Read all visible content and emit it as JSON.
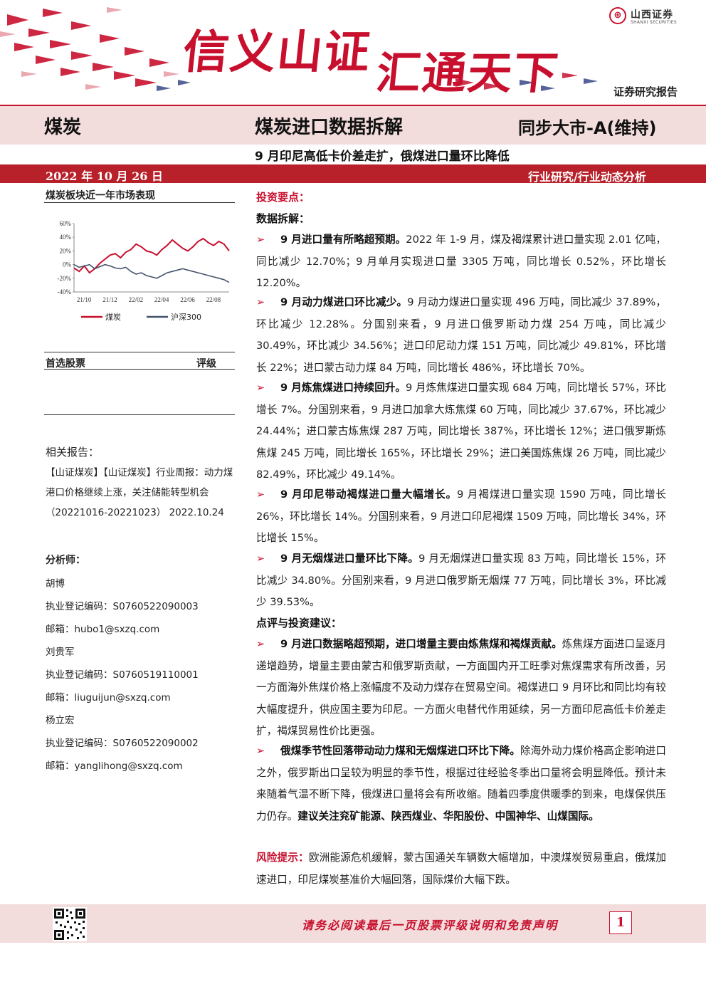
{
  "header": {
    "slogan_part1": "信义山证",
    "slogan_part2": "汇通天下",
    "logo_cn": "山西证券",
    "logo_en": "SHANXI SECURITIES",
    "report_type": "证券研究报告"
  },
  "title_band": {
    "industry": "煤炭",
    "title": "煤炭进口数据拆解",
    "rating": "同步大市-A(维持)",
    "subtitle": "9 月印尼高低卡价差走扩，俄煤进口量环比降低",
    "date": "2022 年 10 月 26 日",
    "research_type": "行业研究/行业动态分析"
  },
  "left": {
    "chart_title": "煤炭板块近一年市场表现",
    "stock_header_left": "首选股票",
    "stock_header_right": "评级",
    "related_title": "相关报告：",
    "related_text": "【山证煤炭】【山证煤炭】行业周报：动力煤港口价格继续上涨，关注储能转型机会（20221016-20221023） 2022.10.24",
    "analyst_title": "分析师：",
    "analysts": [
      "胡博",
      "执业登记编码：S0760522090003",
      "邮箱：hubo1@sxzq.com",
      "刘贵军",
      "执业登记编码：S0760519110001",
      "邮箱：liuguijun@sxzq.com",
      "杨立宏",
      "执业登记编码：S0760522090002",
      "邮箱：yanglihong@sxzq.com"
    ]
  },
  "chart_data": {
    "type": "line",
    "title": "煤炭板块近一年市场表现",
    "x_ticks": [
      "21/10",
      "21/12",
      "22/02",
      "22/04",
      "22/06",
      "22/08"
    ],
    "y_ticks": [
      "60%",
      "40%",
      "20%",
      "0%",
      "-20%",
      "-40%"
    ],
    "ylim": [
      -40,
      60
    ],
    "legend_placement": "bottom",
    "series": [
      {
        "name": "煤炭",
        "color": "#c8102e",
        "values": [
          -5,
          -10,
          -2,
          -12,
          -6,
          2,
          8,
          14,
          16,
          10,
          18,
          22,
          30,
          26,
          20,
          18,
          14,
          22,
          28,
          36,
          30,
          24,
          20,
          26,
          34,
          38,
          32,
          28,
          34,
          30,
          20
        ]
      },
      {
        "name": "沪深300",
        "color": "#44546a",
        "values": [
          0,
          -4,
          -2,
          0,
          -6,
          -3,
          0,
          -2,
          -5,
          -6,
          -4,
          -10,
          -14,
          -12,
          -16,
          -18,
          -20,
          -16,
          -12,
          -10,
          -8,
          -6,
          -8,
          -10,
          -12,
          -14,
          -16,
          -18,
          -20,
          -22,
          -26
        ]
      }
    ]
  },
  "right": {
    "invest_title": "投资要点：",
    "data_title": "数据拆解：",
    "bullets": [
      {
        "lead": "9 月进口量有所略超预期。",
        "text": "2022 年 1-9 月，煤及褐煤累计进口量实现 2.01 亿吨，同比减少 12.70%；9 月单月实现进口量 3305 万吨，同比增长 0.52%，环比增长 12.20%。"
      },
      {
        "lead": "9 月动力煤进口环比减少。",
        "text": "9 月动力煤进口量实现 496 万吨，同比减少 37.89%，环比减少 12.28%。分国别来看，9 月进口俄罗斯动力煤 254 万吨，同比减少 30.49%，环比减少 34.56%；进口印尼动力煤 151 万吨，同比减少 49.81%，环比增长 22%；进口蒙古动力煤 84 万吨，同比增长 486%，环比增长 70%。"
      },
      {
        "lead": "9 月炼焦煤进口持续回升。",
        "text": "9 月炼焦煤进口量实现 684 万吨，同比增长 57%，环比增长 7%。分国别来看，9 月进口加拿大炼焦煤 60 万吨，同比减少 37.67%，环比减少 24.44%；进口蒙古炼焦煤 287 万吨，同比增长 387%，环比增长 12%；进口俄罗斯炼焦煤 245 万吨，同比增长 165%，环比增长 29%；进口美国炼焦煤 26 万吨，同比减少 82.49%，环比减少 49.14%。"
      },
      {
        "lead": "9 月印尼带动褐煤进口量大幅增长。",
        "text": "9 月褐煤进口量实现 1590 万吨，同比增长 26%，环比增长 14%。分国别来看，9 月进口印尼褐煤 1509 万吨，同比增长 34%，环比增长 15%。"
      },
      {
        "lead": "9 月无烟煤进口量环比下降。",
        "text": "9 月无烟煤进口量实现 83 万吨，同比增长 15%，环比减少 34.80%。分国别来看，9 月进口俄罗斯无烟煤 77 万吨，同比增长 3%，环比减少 39.53%。"
      }
    ],
    "comment_title": "点评与投资建议：",
    "advice": [
      {
        "lead": "9 月进口数据略超预期，进口增量主要由炼焦煤和褐煤贡献。",
        "text": "炼焦煤方面进口呈逐月递增趋势，增量主要由蒙古和俄罗斯贡献，一方面国内开工旺季对焦煤需求有所改善，另一方面海外焦煤价格上涨幅度不及动力煤存在贸易空间。褐煤进口 9 月环比和同比均有较大幅度提升，供应国主要为印尼。一方面火电替代作用延续，另一方面印尼高低卡价差走扩，褐煤贸易性价比更强。"
      },
      {
        "lead": "俄煤季节性回落带动动力煤和无烟煤进口环比下降。",
        "text": "除海外动力煤价格高企影响进口之外，俄罗斯出口呈较为明显的季节性，根据过往经验冬季出口量将会明显降低。预计未来随着气温不断下降，俄煤进口量将会有所收缩。随着四季度供暖季的到来，电煤保供压力仍存。",
        "strong": "建议关注兖矿能源、陕西煤业、华阳股份、中国神华、山煤国际。"
      }
    ],
    "risk_label": "风险提示：",
    "risk_text": "欧洲能源危机缓解，蒙古国通关车辆数大幅增加，中澳煤炭贸易重启，俄煤加速进口，印尼煤炭基准价大幅回落，国际煤价大幅下跌。"
  },
  "footer": {
    "disclaimer": "请务必阅读最后一页股票评级说明和免责声明",
    "page_number": "1"
  },
  "colors": {
    "brand_red": "#c8102e",
    "band_red": "#b8202a",
    "band_pink": "#f2dcdc"
  }
}
